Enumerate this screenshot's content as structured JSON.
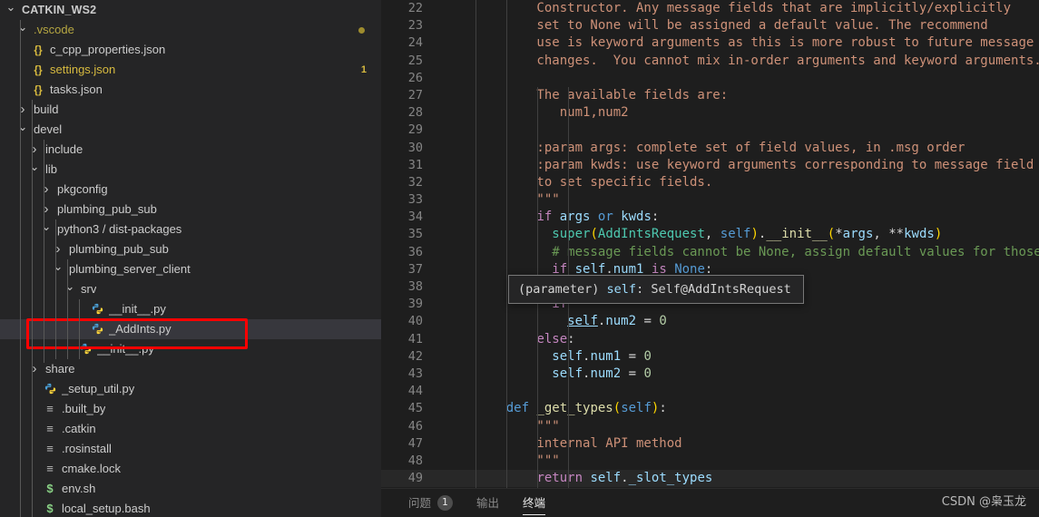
{
  "window": {
    "theme_bg": "#1e1e1e",
    "sidebar_bg": "#252526",
    "accent": "#ff0000"
  },
  "sidebar": {
    "root_label": "CATKIN_WS2",
    "items": [
      {
        "label": ".vscode",
        "indent": 1,
        "twist": "open",
        "icon": "none",
        "badge_dot": true
      },
      {
        "label": "c_cpp_properties.json",
        "indent": 1,
        "twist": "none",
        "icon": "json-icon"
      },
      {
        "label": "settings.json",
        "indent": 1,
        "twist": "none",
        "icon": "json-icon",
        "badge_num": "1",
        "modified": true
      },
      {
        "label": "tasks.json",
        "indent": 1,
        "twist": "none",
        "icon": "json-icon"
      },
      {
        "label": "build",
        "indent": 1,
        "twist": "closed",
        "icon": "none"
      },
      {
        "label": "devel",
        "indent": 1,
        "twist": "open",
        "icon": "none"
      },
      {
        "label": "include",
        "indent": 2,
        "twist": "closed",
        "icon": "none"
      },
      {
        "label": "lib",
        "indent": 2,
        "twist": "open",
        "icon": "none"
      },
      {
        "label": "pkgconfig",
        "indent": 3,
        "twist": "closed",
        "icon": "none"
      },
      {
        "label": "plumbing_pub_sub",
        "indent": 3,
        "twist": "closed",
        "icon": "none"
      },
      {
        "label": "python3 / dist-packages",
        "indent": 3,
        "twist": "open",
        "icon": "none"
      },
      {
        "label": "plumbing_pub_sub",
        "indent": 4,
        "twist": "closed",
        "icon": "none"
      },
      {
        "label": "plumbing_server_client",
        "indent": 4,
        "twist": "open",
        "icon": "none"
      },
      {
        "label": "srv",
        "indent": 5,
        "twist": "open",
        "icon": "none"
      },
      {
        "label": "__init__.py",
        "indent": 6,
        "twist": "none",
        "icon": "python-icon"
      },
      {
        "label": "_AddInts.py",
        "indent": 6,
        "twist": "none",
        "icon": "python-icon",
        "selected": true
      },
      {
        "label": "__init__.py",
        "indent": 5,
        "twist": "none",
        "icon": "python-icon"
      },
      {
        "label": "share",
        "indent": 2,
        "twist": "closed",
        "icon": "none"
      },
      {
        "label": "_setup_util.py",
        "indent": 2,
        "twist": "none",
        "icon": "python-icon"
      },
      {
        "label": ".built_by",
        "indent": 2,
        "twist": "none",
        "icon": "text-icon"
      },
      {
        "label": ".catkin",
        "indent": 2,
        "twist": "none",
        "icon": "text-icon"
      },
      {
        "label": ".rosinstall",
        "indent": 2,
        "twist": "none",
        "icon": "text-icon"
      },
      {
        "label": "cmake.lock",
        "indent": 2,
        "twist": "none",
        "icon": "text-icon"
      },
      {
        "label": "env.sh",
        "indent": 2,
        "twist": "none",
        "icon": "shell-icon"
      },
      {
        "label": "local_setup.bash",
        "indent": 2,
        "twist": "none",
        "icon": "shell-icon"
      }
    ],
    "icons": {
      "json-icon": "{}",
      "python-icon": "◕",
      "text-icon": "≡",
      "shell-icon": "$",
      "chevron-open": "⌄",
      "chevron-closed": "›"
    }
  },
  "editor": {
    "first_line_number": 22,
    "lines": [
      {
        "n": 22,
        "tokens": [
          {
            "t": "        Constructor. Any message fields that are implicitly/explicitly",
            "c": "t-str"
          }
        ]
      },
      {
        "n": 23,
        "tokens": [
          {
            "t": "        set to None will be assigned a default value. The recommend",
            "c": "t-str"
          }
        ]
      },
      {
        "n": 24,
        "tokens": [
          {
            "t": "        use is keyword arguments as this is more robust to future message",
            "c": "t-str"
          }
        ]
      },
      {
        "n": 25,
        "tokens": [
          {
            "t": "        changes.  You cannot mix in-order arguments and keyword arguments.",
            "c": "t-str"
          }
        ]
      },
      {
        "n": 26,
        "tokens": []
      },
      {
        "n": 27,
        "tokens": [
          {
            "t": "        The available fields are:",
            "c": "t-str"
          }
        ]
      },
      {
        "n": 28,
        "tokens": [
          {
            "t": "           num1,num2",
            "c": "t-str"
          }
        ]
      },
      {
        "n": 29,
        "tokens": []
      },
      {
        "n": 30,
        "tokens": [
          {
            "t": "        :param args: complete set of field values, in .msg order",
            "c": "t-str"
          }
        ]
      },
      {
        "n": 31,
        "tokens": [
          {
            "t": "        :param kwds: use keyword arguments corresponding to message field names",
            "c": "t-str"
          }
        ]
      },
      {
        "n": 32,
        "tokens": [
          {
            "t": "        to set specific fields.",
            "c": "t-str"
          }
        ]
      },
      {
        "n": 33,
        "tokens": [
          {
            "t": "        \"\"\"",
            "c": "t-str"
          }
        ]
      },
      {
        "n": 34,
        "tokens": [
          {
            "t": "        ",
            "c": "t-plain"
          },
          {
            "t": "if",
            "c": "t-kw"
          },
          {
            "t": " ",
            "c": "t-plain"
          },
          {
            "t": "args",
            "c": "t-var"
          },
          {
            "t": " ",
            "c": "t-plain"
          },
          {
            "t": "or",
            "c": "t-kw2"
          },
          {
            "t": " ",
            "c": "t-plain"
          },
          {
            "t": "kwds",
            "c": "t-var"
          },
          {
            "t": ":",
            "c": "t-plain"
          }
        ]
      },
      {
        "n": 35,
        "tokens": [
          {
            "t": "          ",
            "c": "t-plain"
          },
          {
            "t": "super",
            "c": "t-cls"
          },
          {
            "t": "(",
            "c": "t-paren"
          },
          {
            "t": "AddIntsRequest",
            "c": "t-cls"
          },
          {
            "t": ", ",
            "c": "t-plain"
          },
          {
            "t": "self",
            "c": "t-kw2"
          },
          {
            "t": ")",
            "c": "t-paren"
          },
          {
            "t": ".",
            "c": "t-plain"
          },
          {
            "t": "__init__",
            "c": "t-fn"
          },
          {
            "t": "(",
            "c": "t-paren"
          },
          {
            "t": "*",
            "c": "t-plain"
          },
          {
            "t": "args",
            "c": "t-var"
          },
          {
            "t": ", ",
            "c": "t-plain"
          },
          {
            "t": "**",
            "c": "t-plain"
          },
          {
            "t": "kwds",
            "c": "t-var"
          },
          {
            "t": ")",
            "c": "t-paren"
          }
        ]
      },
      {
        "n": 36,
        "tokens": [
          {
            "t": "          # message fields cannot be None, assign default values for those that are",
            "c": "t-cmt"
          }
        ]
      },
      {
        "n": 37,
        "tokens": [
          {
            "t": "          ",
            "c": "t-plain"
          },
          {
            "t": "if",
            "c": "t-kw"
          },
          {
            "t": " ",
            "c": "t-plain"
          },
          {
            "t": "self",
            "c": "t-var"
          },
          {
            "t": ".",
            "c": "t-plain"
          },
          {
            "t": "num1",
            "c": "t-var"
          },
          {
            "t": " ",
            "c": "t-plain"
          },
          {
            "t": "is",
            "c": "t-kw"
          },
          {
            "t": " ",
            "c": "t-plain"
          },
          {
            "t": "None",
            "c": "t-kw2"
          },
          {
            "t": ":",
            "c": "t-plain"
          }
        ]
      },
      {
        "n": 38,
        "tokens": []
      },
      {
        "n": 39,
        "tokens": [
          {
            "t": "          ",
            "c": "t-plain"
          },
          {
            "t": "if",
            "c": "t-kw"
          }
        ]
      },
      {
        "n": 40,
        "tokens": [
          {
            "t": "            ",
            "c": "t-plain"
          },
          {
            "t": "self",
            "c": "t-var t-under"
          },
          {
            "t": ".",
            "c": "t-plain"
          },
          {
            "t": "num2",
            "c": "t-var"
          },
          {
            "t": " = ",
            "c": "t-plain"
          },
          {
            "t": "0",
            "c": "t-num"
          }
        ]
      },
      {
        "n": 41,
        "tokens": [
          {
            "t": "        ",
            "c": "t-plain"
          },
          {
            "t": "else",
            "c": "t-kw"
          },
          {
            "t": ":",
            "c": "t-plain"
          }
        ]
      },
      {
        "n": 42,
        "tokens": [
          {
            "t": "          ",
            "c": "t-plain"
          },
          {
            "t": "self",
            "c": "t-var"
          },
          {
            "t": ".",
            "c": "t-plain"
          },
          {
            "t": "num1",
            "c": "t-var"
          },
          {
            "t": " = ",
            "c": "t-plain"
          },
          {
            "t": "0",
            "c": "t-num"
          }
        ]
      },
      {
        "n": 43,
        "tokens": [
          {
            "t": "          ",
            "c": "t-plain"
          },
          {
            "t": "self",
            "c": "t-var"
          },
          {
            "t": ".",
            "c": "t-plain"
          },
          {
            "t": "num2",
            "c": "t-var"
          },
          {
            "t": " = ",
            "c": "t-plain"
          },
          {
            "t": "0",
            "c": "t-num"
          }
        ]
      },
      {
        "n": 44,
        "tokens": []
      },
      {
        "n": 45,
        "tokens": [
          {
            "t": "    ",
            "c": "t-plain"
          },
          {
            "t": "def",
            "c": "t-kw2"
          },
          {
            "t": " ",
            "c": "t-plain"
          },
          {
            "t": "_get_types",
            "c": "t-fn"
          },
          {
            "t": "(",
            "c": "t-paren"
          },
          {
            "t": "self",
            "c": "t-kw2"
          },
          {
            "t": ")",
            "c": "t-paren"
          },
          {
            "t": ":",
            "c": "t-plain"
          }
        ]
      },
      {
        "n": 46,
        "tokens": [
          {
            "t": "        \"\"\"",
            "c": "t-str"
          }
        ]
      },
      {
        "n": 47,
        "tokens": [
          {
            "t": "        internal API method",
            "c": "t-str"
          }
        ]
      },
      {
        "n": 48,
        "tokens": [
          {
            "t": "        \"\"\"",
            "c": "t-str"
          }
        ]
      },
      {
        "n": 49,
        "tokens": [
          {
            "t": "        ",
            "c": "t-plain"
          },
          {
            "t": "return",
            "c": "t-kw"
          },
          {
            "t": " ",
            "c": "t-plain"
          },
          {
            "t": "self",
            "c": "t-var"
          },
          {
            "t": ".",
            "c": "t-plain"
          },
          {
            "t": "_slot_types",
            "c": "t-var"
          }
        ],
        "current": true
      }
    ],
    "hover_tooltip": {
      "prefix": "(parameter) ",
      "name": "self",
      "suffix": ": Self@AddIntsRequest"
    }
  },
  "panel": {
    "tabs": [
      {
        "label": "问题",
        "count": "1",
        "active": false
      },
      {
        "label": "输出",
        "count": null,
        "active": false
      },
      {
        "label": "终端",
        "count": null,
        "active": true
      }
    ],
    "watermark": "CSDN @枭玉龙"
  }
}
